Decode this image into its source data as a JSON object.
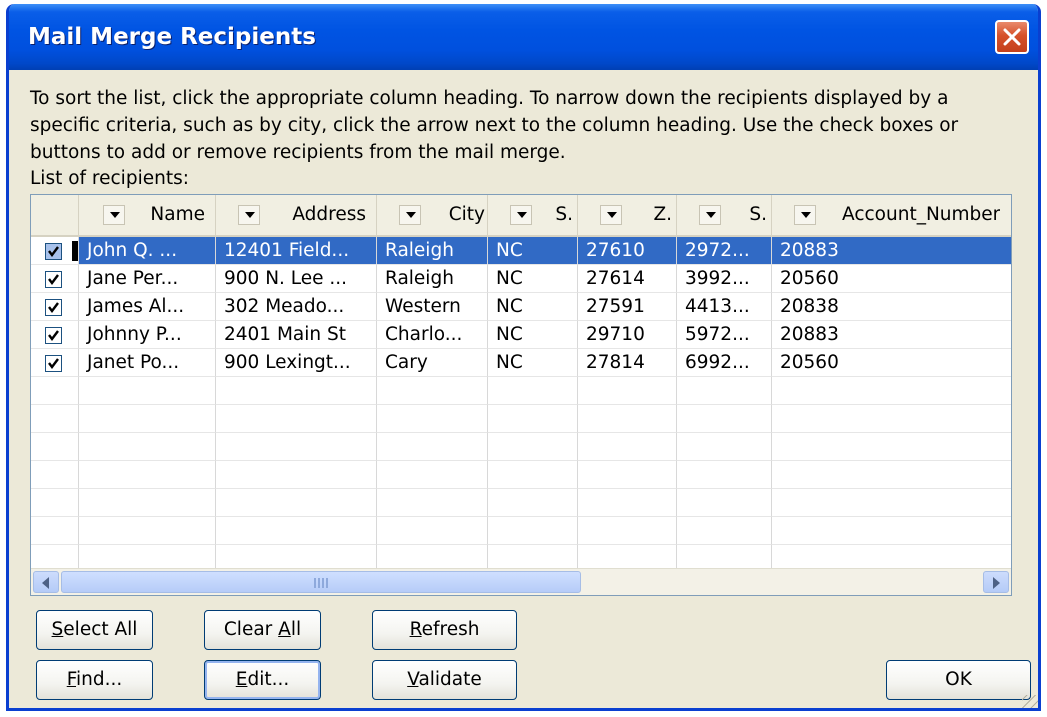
{
  "window": {
    "title": "Mail Merge Recipients"
  },
  "instructions": "To sort the list, click the appropriate column heading.  To narrow down the recipients displayed by a specific criteria, such as by city, click the arrow next to the column heading.  Use the check boxes or buttons to add or remove recipients from the mail merge.",
  "list_label": "List of recipients:",
  "columns": [
    "Name",
    "Address",
    "City",
    "S.",
    "Z.",
    "S.",
    "Account_Number"
  ],
  "rows": [
    {
      "checked": true,
      "selected": true,
      "cells": [
        "John Q. ...",
        "12401 Field...",
        "Raleigh",
        "NC",
        "27610",
        "2972...",
        "20883"
      ]
    },
    {
      "checked": true,
      "selected": false,
      "cells": [
        "Jane Per...",
        "900 N. Lee ...",
        "Raleigh",
        "NC",
        "27614",
        "3992...",
        "20560"
      ]
    },
    {
      "checked": true,
      "selected": false,
      "cells": [
        "James Al...",
        "302 Meado...",
        "Western",
        "NC",
        "27591",
        "4413...",
        "20838"
      ]
    },
    {
      "checked": true,
      "selected": false,
      "cells": [
        "Johnny P...",
        "2401 Main St",
        "Charlo...",
        "NC",
        "29710",
        "5972...",
        "20883"
      ]
    },
    {
      "checked": true,
      "selected": false,
      "cells": [
        "Janet Po...",
        "900 Lexingt...",
        "Cary",
        "NC",
        "27814",
        "6992...",
        "20560"
      ]
    }
  ],
  "buttons": {
    "select_all": {
      "pre": "",
      "key": "S",
      "post": "elect All"
    },
    "clear_all": {
      "pre": "Clear ",
      "key": "A",
      "post": "ll"
    },
    "refresh": {
      "pre": "",
      "key": "R",
      "post": "efresh"
    },
    "find": {
      "pre": "",
      "key": "F",
      "post": "ind..."
    },
    "edit": {
      "pre": "",
      "key": "E",
      "post": "dit..."
    },
    "validate": {
      "pre": "",
      "key": "V",
      "post": "alidate"
    },
    "ok": {
      "pre": "OK",
      "key": "",
      "post": ""
    }
  },
  "colors": {
    "titlebar": "#0054e3",
    "selection": "#316ac5",
    "dialog_bg": "#ece9d8",
    "close_button": "#d6522b"
  }
}
